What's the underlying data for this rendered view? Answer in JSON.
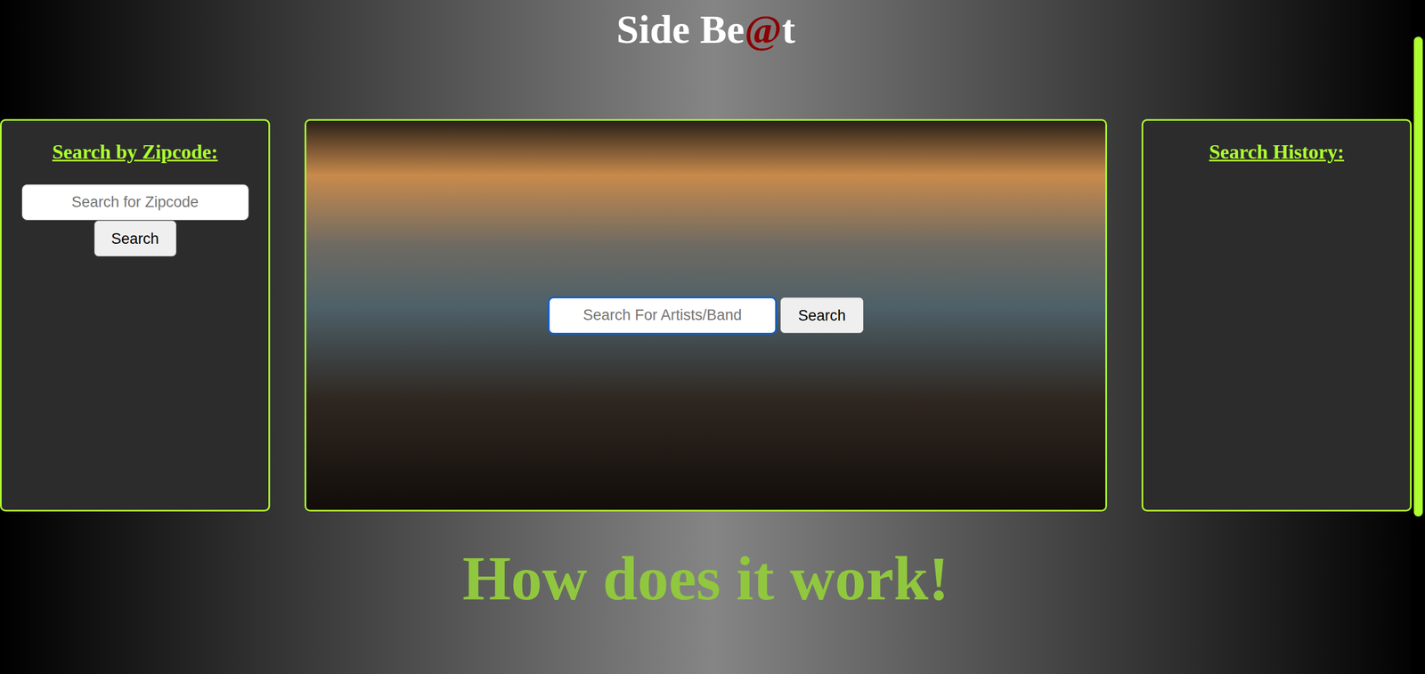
{
  "title": {
    "before": "Side Be",
    "accent": "@",
    "after": "t"
  },
  "zipcode_panel": {
    "heading": "Search by Zipcode:",
    "placeholder": "Search for Zipcode",
    "button": "Search"
  },
  "hero": {
    "placeholder": "Search For Artists/Band",
    "button": "Search",
    "focused": true
  },
  "history_panel": {
    "heading": "Search History:",
    "items": []
  },
  "how_heading": "How does it work!"
}
